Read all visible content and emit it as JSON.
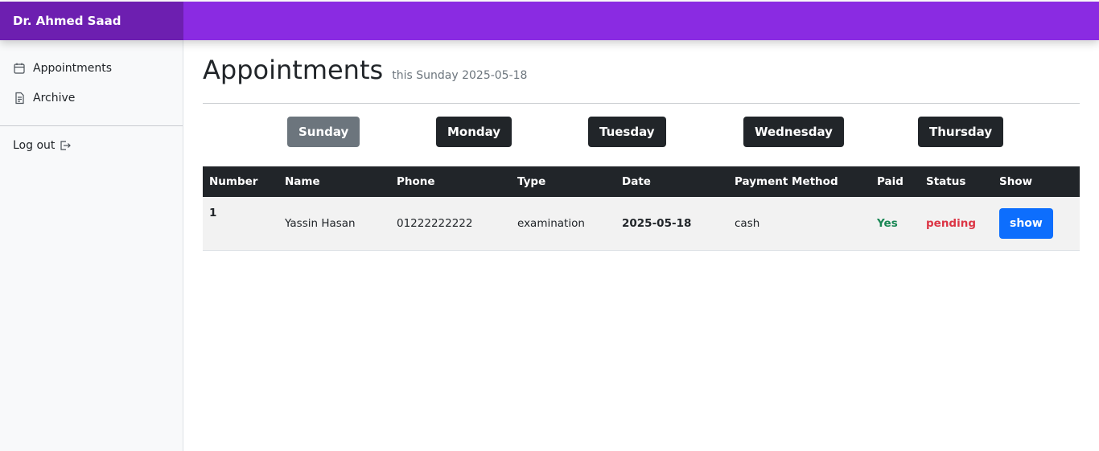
{
  "brand": {
    "name": "Dr. Ahmed Saad"
  },
  "sidebar": {
    "items": [
      {
        "label": "Appointments",
        "icon": "calendar-icon"
      },
      {
        "label": "Archive",
        "icon": "file-text-icon"
      }
    ],
    "logout": {
      "label": "Log out",
      "icon": "box-arrow-right-icon"
    }
  },
  "page": {
    "title": "Appointments",
    "subtitle": "this Sunday 2025-05-18"
  },
  "days": [
    "Sunday",
    "Monday",
    "Tuesday",
    "Wednesday",
    "Thursday"
  ],
  "active_day": "Sunday",
  "table": {
    "headers": [
      "Number",
      "Name",
      "Phone",
      "Type",
      "Date",
      "Payment Method",
      "Paid",
      "Status",
      "Show"
    ],
    "rows": [
      {
        "number": "1",
        "name": "Yassin Hasan",
        "phone": "01222222222",
        "type": "examination",
        "date": "2025-05-18",
        "payment_method": "cash",
        "paid": "Yes",
        "status": "pending",
        "show_label": "show"
      }
    ]
  },
  "colors": {
    "topbar": "#8a2be2",
    "brand_bg": "#6d1fb0",
    "paid_yes": "#198754",
    "status_pending": "#dc3545",
    "show_button": "#0d6efd"
  }
}
